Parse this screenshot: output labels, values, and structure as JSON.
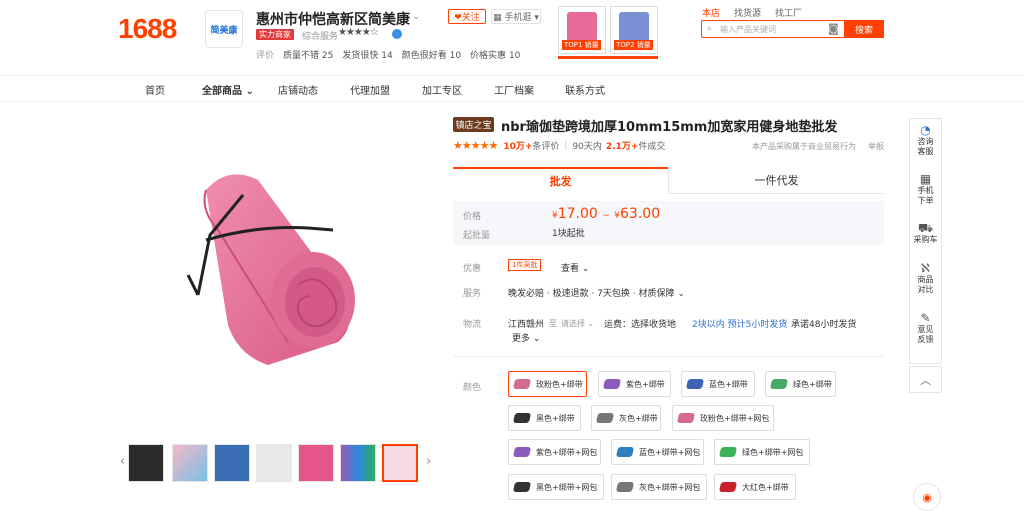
{
  "header": {
    "logo": "1688",
    "shop_logo": "简美康",
    "shop_name": "惠州市仲恺高新区简美康",
    "follow": "❤关注",
    "mobile": "▦ 手机逛 ▾",
    "strength_badge": "实力商家",
    "service_label": "综合服务",
    "service_stars": "★★★★☆",
    "ratings_label": "评价",
    "ratings": [
      {
        "k": "质量不错",
        "v": "25"
      },
      {
        "k": "发货很快",
        "v": "14"
      },
      {
        "k": "颜色很好看",
        "v": "10"
      },
      {
        "k": "价格实惠",
        "v": "10"
      }
    ],
    "ad_thumbs": [
      {
        "label": "TOP1 销量",
        "color": "#e86a9a"
      },
      {
        "label": "TOP2 销量",
        "color": "#7a8fd6"
      }
    ],
    "search_scope": [
      "本店",
      "找货源",
      "找工厂"
    ],
    "search_placeholder": "输入产品关键词",
    "search_button": "搜索"
  },
  "nav": [
    "首页",
    "全部商品 ⌄",
    "店铺动态",
    "代理加盟",
    "加工专区",
    "工厂档案",
    "联系方式"
  ],
  "product": {
    "badge": "镇店之宝",
    "title": "nbr瑜伽垫跨境加厚10mm15mm加宽家用健身地垫批发",
    "stars": "★★★★★",
    "review_count": "10万+",
    "review_label": "条评价",
    "sales_period": "90天内",
    "sales_count": "2.1万+",
    "sales_label": "件成交",
    "note": "本产品采购属于商业贸易行为",
    "report": "举报"
  },
  "tabs": [
    "批发",
    "一件代发"
  ],
  "price": {
    "price_label": "价格",
    "currency": "¥",
    "low": "17.00",
    "range_sep": "~",
    "high": "63.00",
    "moq_label": "起批量",
    "moq": "1块起批"
  },
  "offers": {
    "label": "优惠",
    "tag": "1件采批",
    "view": "查看 ⌄"
  },
  "service": {
    "label": "服务",
    "value": "晚发必赔 · 极速退款 · 7天包换 · 材质保障 ⌄"
  },
  "logistics": {
    "label": "物流",
    "from": "江西赣州",
    "to_label": "至",
    "to_select": "请选择 ⌄",
    "freight": "运费：选择收货地",
    "ship_time": "2块以内 预计5小时发货",
    "promise": "承诺48小时发货",
    "more": "更多 ⌄"
  },
  "color_label": "颜色",
  "colors": [
    {
      "name": "玫粉色+绑带",
      "sw": "#d66b92"
    },
    {
      "name": "紫色+绑带",
      "sw": "#8a5bb8"
    },
    {
      "name": "蓝色+绑带",
      "sw": "#3e63b5"
    },
    {
      "name": "绿色+绑带",
      "sw": "#4aa86a"
    },
    {
      "name": "黑色+绑带",
      "sw": "#333333"
    },
    {
      "name": "灰色+绑带",
      "sw": "#777777"
    },
    {
      "name": "玫粉色+绑带+网包",
      "sw": "#d66b92"
    },
    {
      "name": "紫色+绑带+网包",
      "sw": "#8a5bb8"
    },
    {
      "name": "蓝色+绑带+网包",
      "sw": "#2f7fbf"
    },
    {
      "name": "绿色+绑带+网包",
      "sw": "#3bb35a"
    },
    {
      "name": "黑色+绑带+网包",
      "sw": "#333333"
    },
    {
      "name": "灰色+绑带+网包",
      "sw": "#777777"
    },
    {
      "name": "大红色+绑带",
      "sw": "#c8202a"
    }
  ],
  "float_bar": [
    {
      "icon": "◔",
      "label": "咨询\n客服"
    },
    {
      "icon": "▦",
      "label": "手机\n下单"
    },
    {
      "icon": "🛒",
      "label": "采购车"
    },
    {
      "icon": "⊼",
      "label": "商品\n对比"
    },
    {
      "icon": "✎",
      "label": "意见\n反馈"
    }
  ],
  "colors_theme": {
    "accent": "#ff4000"
  }
}
